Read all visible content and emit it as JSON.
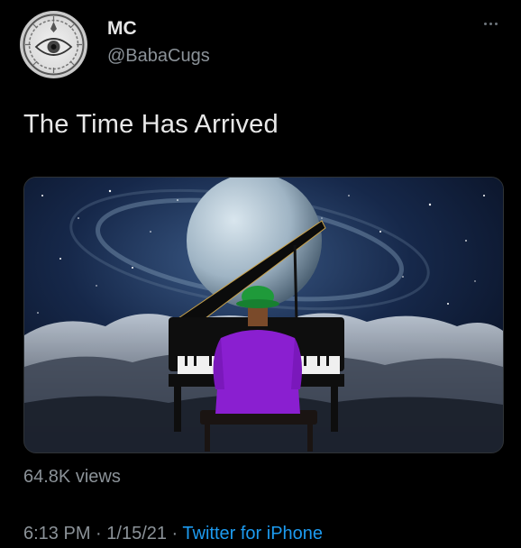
{
  "author": {
    "name": "MC",
    "handle": "@BabaCugs"
  },
  "tweet": {
    "text": "The Time Has Arrived",
    "views": "64.8K views",
    "time": "6:13 PM",
    "separator1": " · ",
    "date": "1/15/21",
    "separator2": " · ",
    "source": "Twitter for iPhone"
  },
  "icons": {
    "more": "more-dots-icon",
    "avatar": "eye-emblem"
  },
  "colors": {
    "background": "#000000",
    "link": "#1d9bf0",
    "secondary_text": "#8b9298",
    "shirt": "#8a1fd0",
    "hat": "#1f9a3a"
  }
}
